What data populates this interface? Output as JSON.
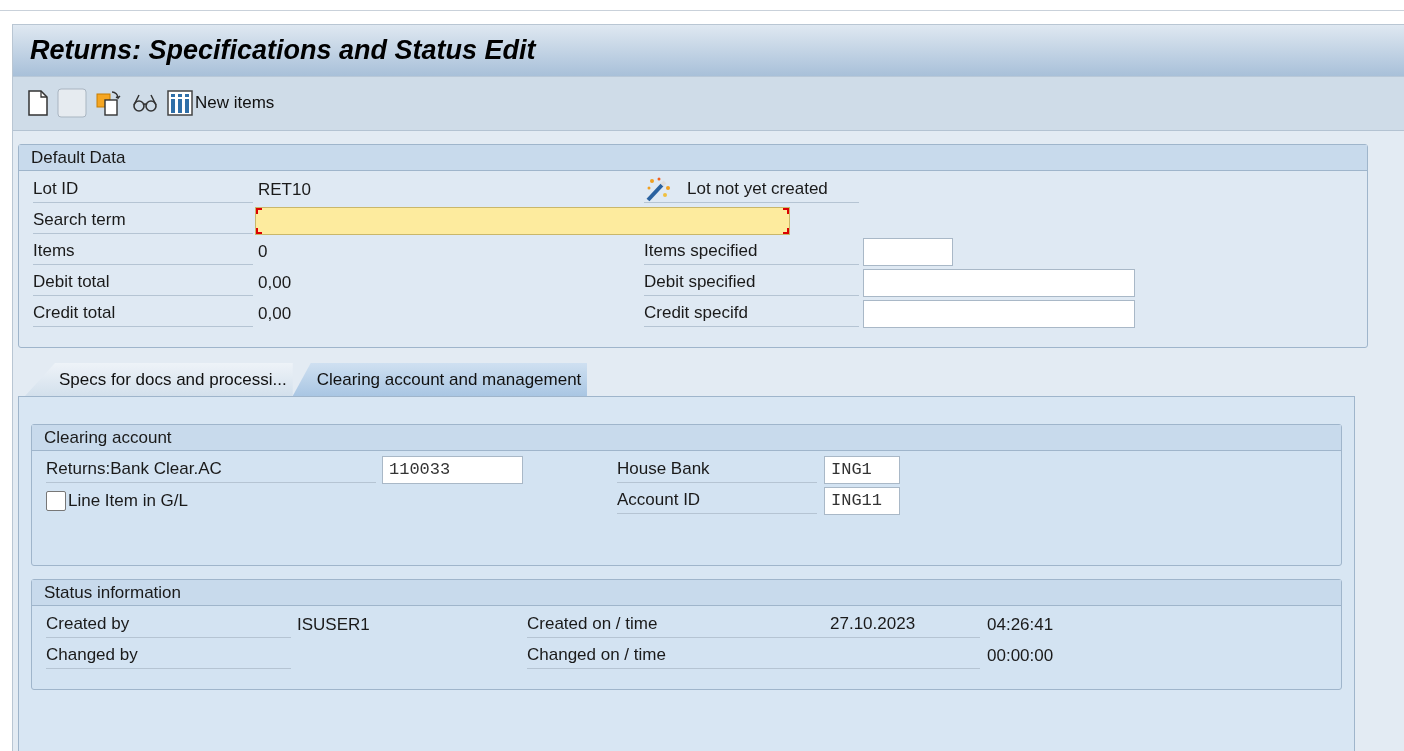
{
  "window": {
    "title": "Returns: Specifications and Status Edit"
  },
  "toolbar": [
    {
      "kind": "document"
    },
    {
      "kind": "blank"
    },
    {
      "kind": "copy"
    },
    {
      "kind": "glasses"
    },
    {
      "kind": "columns",
      "label": "New items"
    }
  ],
  "default_data": {
    "title": "Default Data",
    "rows": [
      {
        "label": "Lot ID",
        "value": "RET10",
        "status": {
          "text": "Lot not yet created"
        }
      },
      {
        "label": "Search term",
        "field": {
          "focused": true
        }
      },
      {
        "label": "Items",
        "value": "0",
        "right_label": "Items specified",
        "right_field": {
          "kind": "count"
        }
      },
      {
        "label": "Debit total",
        "value": "0,00",
        "right_label": "Debit specified",
        "right_field": {
          "kind": "amount"
        }
      },
      {
        "label": "Credit total",
        "value": "0,00",
        "right_label": "Credit specifd",
        "right_field": {
          "kind": "amount"
        }
      }
    ]
  },
  "tabs": [
    {
      "label": "Specs for docs and processi...",
      "selected": false
    },
    {
      "label": "Clearing account and management",
      "selected": true
    }
  ],
  "clearing_account": {
    "title": "Clearing account",
    "rows": [
      {
        "label": "Returns:Bank Clear.AC",
        "field": {
          "value": "110033"
        },
        "right_label": "House Bank",
        "right_field": {
          "value": "ING1"
        }
      },
      {
        "checkbox": {
          "label": "Line Item in G/L",
          "checked": false
        },
        "right_label": "Account ID",
        "right_field": {
          "value": "ING11"
        }
      }
    ]
  },
  "status_information": {
    "title": "Status information",
    "rows": [
      {
        "label": "Created by",
        "value": "ISUSER1",
        "label2": "Created on / time",
        "date": "27.10.2023",
        "time": "04:26:41"
      },
      {
        "label": "Changed by",
        "label2": "Changed on / time",
        "time": "00:00:00"
      }
    ]
  }
}
